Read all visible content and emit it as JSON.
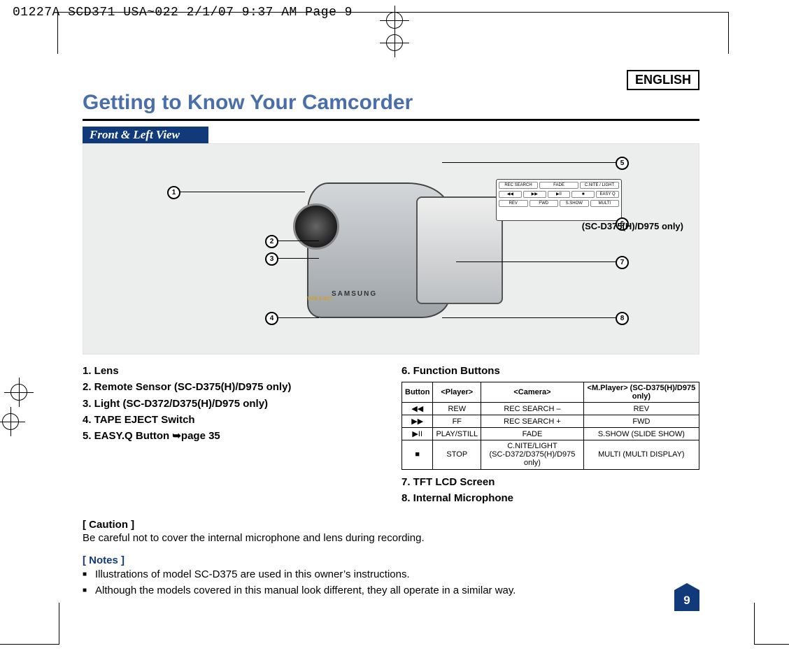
{
  "print": {
    "slug": "01227A SCD371 USA~022  2/1/07 9:37 AM  Page 9"
  },
  "language": "ENGLISH",
  "title": "Getting to Know Your Camcorder",
  "subhead": "Front & Left View",
  "diagram": {
    "model_note": "(SC-D375(H)/D975 only)",
    "brand": "SAMSUNG",
    "tape_label": "TAPE\nEJECT",
    "panel": {
      "r1": [
        "REC SEARCH",
        "FADE",
        "C.NITE / LIGHT"
      ],
      "r2": [
        "◀◀",
        "▶▶",
        "▶II",
        "■",
        "EASY Q"
      ],
      "r3": [
        "REV",
        "FWD",
        "S.SHOW",
        "MULTI"
      ]
    },
    "callouts": {
      "c1": "1",
      "c2": "2",
      "c3": "3",
      "c4": "4",
      "c5": "5",
      "c6": "6",
      "c7": "7",
      "c8": "8"
    }
  },
  "parts_left": [
    "1.  Lens",
    "2.  Remote Sensor (SC-D375(H)/D975 only)",
    "3.  Light (SC-D372/D375(H)/D975 only)",
    "4.  TAPE EJECT Switch",
    "5.  EASY.Q Button ➥page 35"
  ],
  "parts_right_head": "6.  Function Buttons",
  "table": {
    "head": [
      "Button",
      "<Player>",
      "<Camera>",
      "<M.Player> (SC-D375(H)/D975 only)"
    ],
    "rows": [
      {
        "icon": "◀◀",
        "player": "REW",
        "camera": "REC SEARCH –",
        "mplayer": "REV"
      },
      {
        "icon": "▶▶",
        "player": "FF",
        "camera": "REC SEARCH +",
        "mplayer": "FWD"
      },
      {
        "icon": "▶II",
        "player": "PLAY/STILL",
        "camera": "FADE",
        "mplayer": "S.SHOW (SLIDE SHOW)"
      },
      {
        "icon": "■",
        "player": "STOP",
        "camera": "C.NITE/LIGHT\n(SC-D372/D375(H)/D975 only)",
        "mplayer": "MULTI (MULTI DISPLAY)"
      }
    ]
  },
  "parts_right_tail": [
    "7.  TFT LCD Screen",
    "8.  Internal Microphone"
  ],
  "caution_head": "[ Caution ]",
  "caution_body": "Be careful not to cover the internal microphone and lens during recording.",
  "notes_head": "[ Notes ]",
  "notes": [
    "Illustrations of model SC-D375 are used in this owner’s instructions.",
    "Although the models covered in this manual look different, they all operate in a similar way."
  ],
  "page_number": "9"
}
